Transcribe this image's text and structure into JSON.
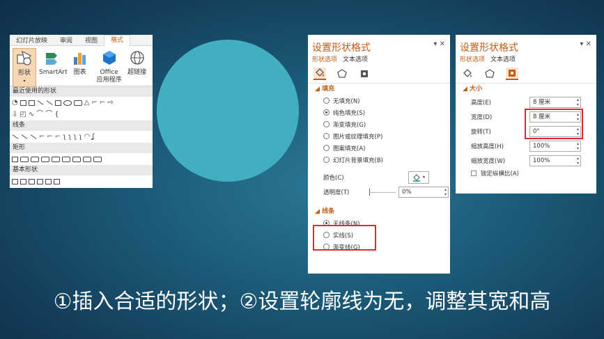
{
  "ribbon": {
    "tabs": [
      "幻灯片放映",
      "审阅",
      "视图",
      "格式"
    ],
    "buttons": [
      {
        "label": "形状"
      },
      {
        "label": "SmartArt"
      },
      {
        "label": "图表"
      },
      {
        "label": "Office",
        "label2": "应用程序"
      },
      {
        "label": "超链接"
      }
    ],
    "gallery": {
      "recent": "最近使用的形状",
      "lines": "线条",
      "rectangles": "矩形",
      "basic": "基本形状"
    }
  },
  "circle_color": "#41afbf",
  "format_fill": {
    "title": "设置形状格式",
    "tab_shape": "形状选项",
    "tab_text": "文本选项",
    "fill_section": "填充",
    "fill_options": [
      "无填充(N)",
      "纯色填充(S)",
      "渐变填充(G)",
      "图片或纹理填充(P)",
      "图案填充(A)",
      "幻灯片背景填充(B)"
    ],
    "fill_selected": 1,
    "color_label": "颜色(C)",
    "transparency_label": "透明度(T)",
    "transparency_value": "0%",
    "line_section": "线条",
    "line_options": [
      "无线条(N)",
      "实线(S)",
      "渐变线(G)"
    ],
    "line_selected": 0
  },
  "format_size": {
    "title": "设置形状格式",
    "tab_shape": "形状选项",
    "tab_text": "文本选项",
    "size_section": "大小",
    "height_label": "高度(E)",
    "height_value": "8 厘米",
    "width_label": "宽度(D)",
    "width_value": "8 厘米",
    "rotation_label": "旋转(T)",
    "rotation_value": "0°",
    "scale_height_label": "缩放高度(H)",
    "scale_height_value": "100%",
    "scale_width_label": "缩放宽度(W)",
    "scale_width_value": "100%",
    "lock_ratio_label": "锁定纵横比(A)"
  },
  "caption": "①插入合适的形状；②设置轮廓线为无，调整其宽和高"
}
